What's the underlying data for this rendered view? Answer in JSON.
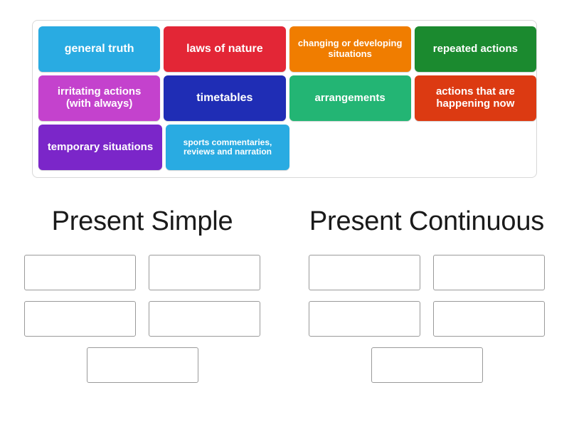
{
  "activity": {
    "type": "group-sort",
    "tile_bank": {
      "name": "answer-tiles",
      "rows": [
        [
          {
            "id": "tile-general-truth",
            "label": "general truth",
            "color": "#29abe2",
            "size": "fs-16"
          },
          {
            "id": "tile-laws-of-nature",
            "label": "laws of nature",
            "color": "#e32636",
            "size": "fs-16"
          },
          {
            "id": "tile-changing-developing-situations",
            "label": "changing or developing situations",
            "color": "#f07d00",
            "size": "fs-13"
          },
          {
            "id": "tile-repeated-actions",
            "label": "repeated actions",
            "color": "#1b8a2f",
            "size": "fs-15"
          }
        ],
        [
          {
            "id": "tile-irritating-actions",
            "label": "irritating actions (with always)",
            "label_plain": "irritating actions",
            "label_bold_part": "always",
            "label_line2_prefix": "(with ",
            "label_line2_suffix": ")",
            "color": "#c442cd",
            "size": "fs-15"
          },
          {
            "id": "tile-timetables",
            "label": "timetables",
            "color": "#1f2db5",
            "size": "fs-16"
          },
          {
            "id": "tile-arrangements",
            "label": "arrangements",
            "color": "#23b574",
            "size": "fs-15"
          },
          {
            "id": "tile-actions-happening-now",
            "label": "actions that are happening now",
            "color": "#dc3a12",
            "size": "fs-15"
          }
        ],
        [
          {
            "id": "tile-temporary-situations",
            "label": "temporary situations",
            "color": "#7b26c9",
            "size": "fs-15"
          },
          {
            "id": "tile-sports-commentaries",
            "label": "sports commentaries, reviews and narration",
            "color": "#29abe2",
            "size": "fs-12"
          }
        ]
      ]
    },
    "columns": [
      {
        "id": "column-present-simple",
        "heading": "Present Simple",
        "drop_zones": [
          {
            "id": "ps-zone-1",
            "value": ""
          },
          {
            "id": "ps-zone-2",
            "value": ""
          },
          {
            "id": "ps-zone-3",
            "value": ""
          },
          {
            "id": "ps-zone-4",
            "value": ""
          },
          {
            "id": "ps-zone-5",
            "value": ""
          }
        ]
      },
      {
        "id": "column-present-continuous",
        "heading": "Present Continuous",
        "drop_zones": [
          {
            "id": "pc-zone-1",
            "value": ""
          },
          {
            "id": "pc-zone-2",
            "value": ""
          },
          {
            "id": "pc-zone-3",
            "value": ""
          },
          {
            "id": "pc-zone-4",
            "value": ""
          },
          {
            "id": "pc-zone-5",
            "value": ""
          }
        ]
      }
    ],
    "colors": {
      "tile_bank_border": "#d8d8d8",
      "drop_zone_border": "#9a9a9a",
      "page_background": "#ffffff",
      "heading_text": "#1a1a1a",
      "tile_text": "#ffffff"
    }
  }
}
